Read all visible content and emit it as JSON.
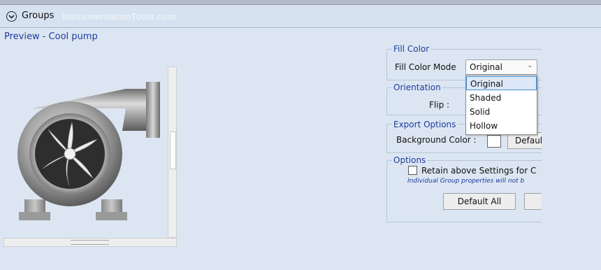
{
  "header": {
    "title": "Groups",
    "watermark": "InstrumentationTools.com"
  },
  "preview": {
    "title": "Preview - Cool pump"
  },
  "fill_color": {
    "legend": "Fill Color",
    "mode_label": "Fill Color Mode",
    "mode_value": "Original",
    "options": [
      "Original",
      "Shaded",
      "Solid",
      "Hollow"
    ]
  },
  "orientation": {
    "legend": "Orientation",
    "flip_label": "Flip :"
  },
  "export_options": {
    "legend": "Export Options",
    "bg_label": "Background Color :",
    "default_button": "Default"
  },
  "options": {
    "legend": "Options",
    "retain_label": "Retain above Settings for C",
    "note": "Individual Group properties will not b",
    "default_all_button": "Default All"
  }
}
